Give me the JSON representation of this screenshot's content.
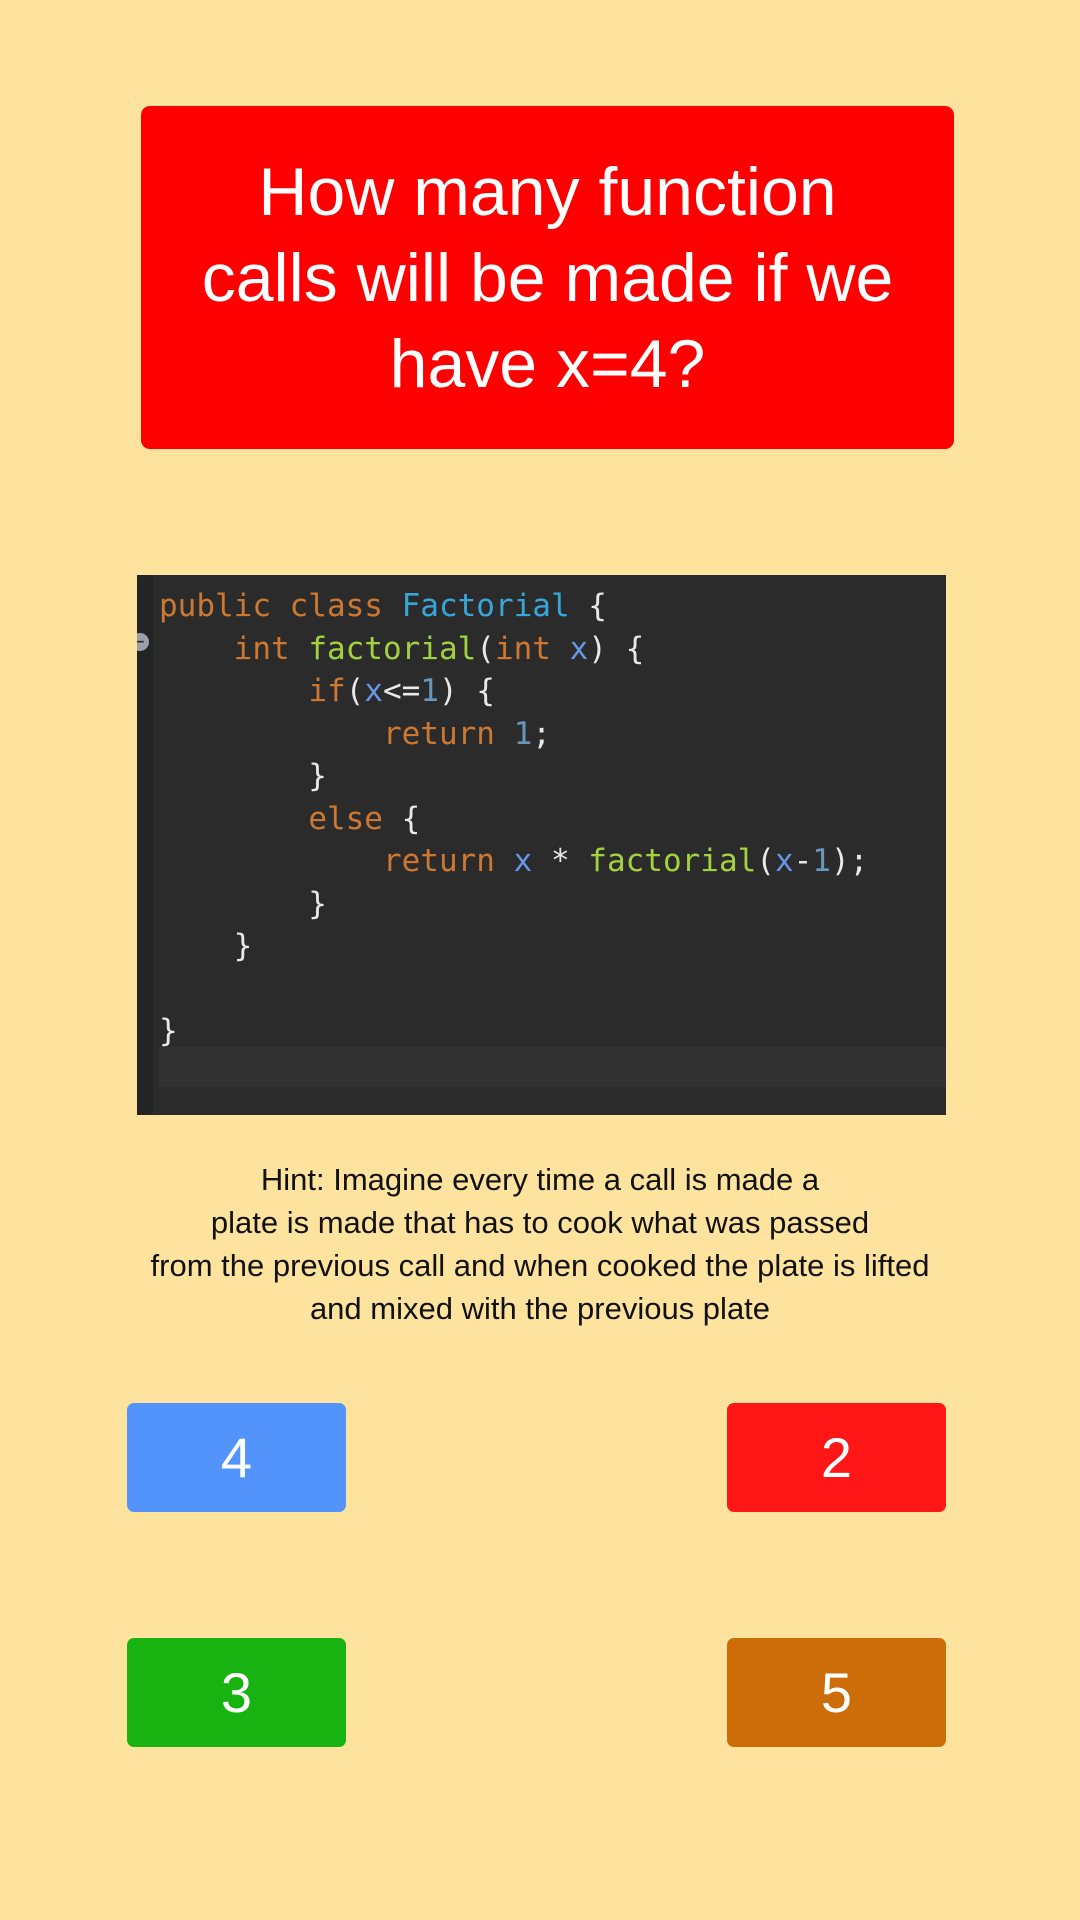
{
  "question": {
    "text": "How many function calls will be made if we have x=4?"
  },
  "code": {
    "lines": [
      [
        {
          "t": "public class ",
          "c": "kw"
        },
        {
          "t": "Factorial",
          "c": "cls"
        },
        {
          "t": " {",
          "c": "plain"
        }
      ],
      [
        {
          "t": "    ",
          "c": "plain"
        },
        {
          "t": "int ",
          "c": "kw"
        },
        {
          "t": "factorial",
          "c": "fn"
        },
        {
          "t": "(",
          "c": "plain"
        },
        {
          "t": "int ",
          "c": "kw"
        },
        {
          "t": "x",
          "c": "var"
        },
        {
          "t": ") {",
          "c": "plain"
        }
      ],
      [
        {
          "t": "        ",
          "c": "plain"
        },
        {
          "t": "if",
          "c": "kw"
        },
        {
          "t": "(",
          "c": "plain"
        },
        {
          "t": "x",
          "c": "var"
        },
        {
          "t": "<=",
          "c": "plain"
        },
        {
          "t": "1",
          "c": "num"
        },
        {
          "t": ") {",
          "c": "plain"
        }
      ],
      [
        {
          "t": "            ",
          "c": "plain"
        },
        {
          "t": "return ",
          "c": "kw"
        },
        {
          "t": "1",
          "c": "num"
        },
        {
          "t": ";",
          "c": "plain"
        }
      ],
      [
        {
          "t": "        }",
          "c": "plain"
        }
      ],
      [
        {
          "t": "        ",
          "c": "plain"
        },
        {
          "t": "else",
          "c": "kw"
        },
        {
          "t": " {",
          "c": "plain"
        }
      ],
      [
        {
          "t": "            ",
          "c": "plain"
        },
        {
          "t": "return ",
          "c": "kw"
        },
        {
          "t": "x",
          "c": "var"
        },
        {
          "t": " * ",
          "c": "plain"
        },
        {
          "t": "factorial",
          "c": "fn"
        },
        {
          "t": "(",
          "c": "plain"
        },
        {
          "t": "x",
          "c": "var"
        },
        {
          "t": "-",
          "c": "plain"
        },
        {
          "t": "1",
          "c": "num"
        },
        {
          "t": ");",
          "c": "plain"
        }
      ],
      [
        {
          "t": "        }",
          "c": "plain"
        }
      ],
      [
        {
          "t": "    }",
          "c": "plain"
        }
      ],
      [
        {
          "t": "",
          "c": "plain"
        }
      ],
      [
        {
          "t": "}",
          "c": "plain"
        }
      ]
    ],
    "fold_icon": "collapse-fold-icon"
  },
  "hint": {
    "lines": [
      "Hint: Imagine every time a call is made a",
      "plate is made that has to cook what was passed",
      "from the previous call and when cooked the plate is lifted",
      "and mixed with the previous plate"
    ]
  },
  "answers": {
    "a": "4",
    "b": "2",
    "c": "3",
    "d": "5"
  },
  "colors": {
    "background": "#fee39f",
    "question_box": "#ff0000",
    "code_bg": "#2b2b2b",
    "answer_blue": "#5394fc",
    "answer_red": "#ff1616",
    "answer_green": "#18b311",
    "answer_orange": "#cc6d0a"
  }
}
